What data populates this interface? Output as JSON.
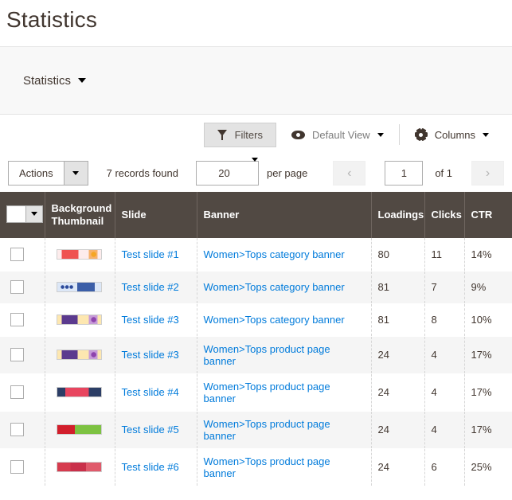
{
  "page": {
    "title": "Statistics"
  },
  "panel": {
    "dropdown_label": "Statistics",
    "caret_icon": "caret-down-icon"
  },
  "toolbar": {
    "filters_label": "Filters",
    "filters_icon": "funnel-icon",
    "view_icon": "eye-icon",
    "view_label": "Default View",
    "columns_icon": "gear-icon",
    "columns_label": "Columns",
    "caret_icon": "caret-down-icon"
  },
  "pager": {
    "actions_label": "Actions",
    "records_found": "7 records found",
    "per_page_value": "20",
    "per_page_label": "per page",
    "prev_icon": "chevron-left-icon",
    "next_icon": "chevron-right-icon",
    "current_page": "1",
    "of_pages": "of 1"
  },
  "table": {
    "columns": [
      {
        "key": "check",
        "label": ""
      },
      {
        "key": "thumb",
        "label": "Background Thumbnail"
      },
      {
        "key": "slide",
        "label": "Slide"
      },
      {
        "key": "banner",
        "label": "Banner"
      },
      {
        "key": "load",
        "label": "Loadings"
      },
      {
        "key": "click",
        "label": "Clicks"
      },
      {
        "key": "ctr",
        "label": "CTR"
      }
    ],
    "rows": [
      {
        "slide": "Test slide #1",
        "banner": "Women>Tops category banner",
        "loadings": "80",
        "clicks": "11",
        "ctr": "14%",
        "thumb_style": "thumb-a"
      },
      {
        "slide": "Test slide #2",
        "banner": "Women>Tops category banner",
        "loadings": "81",
        "clicks": "7",
        "ctr": "9%",
        "thumb_style": "thumb-b"
      },
      {
        "slide": "Test slide #3",
        "banner": "Women>Tops category banner",
        "loadings": "81",
        "clicks": "8",
        "ctr": "10%",
        "thumb_style": "thumb-c"
      },
      {
        "slide": "Test slide #3",
        "banner": "Women>Tops product page banner",
        "loadings": "24",
        "clicks": "4",
        "ctr": "17%",
        "thumb_style": "thumb-c"
      },
      {
        "slide": "Test slide #4",
        "banner": "Women>Tops product page banner",
        "loadings": "24",
        "clicks": "4",
        "ctr": "17%",
        "thumb_style": "thumb-d"
      },
      {
        "slide": "Test slide #5",
        "banner": "Women>Tops product page banner",
        "loadings": "24",
        "clicks": "4",
        "ctr": "17%",
        "thumb_style": "thumb-e"
      },
      {
        "slide": "Test slide #6",
        "banner": "Women>Tops product page banner",
        "loadings": "24",
        "clicks": "6",
        "ctr": "25%",
        "thumb_style": "thumb-f"
      }
    ]
  },
  "colors": {
    "header_bg": "#514943",
    "link": "#007bdb",
    "text": "#41362f",
    "panel_bg": "#f8f8f8",
    "stripe": "#f5f5f5"
  }
}
